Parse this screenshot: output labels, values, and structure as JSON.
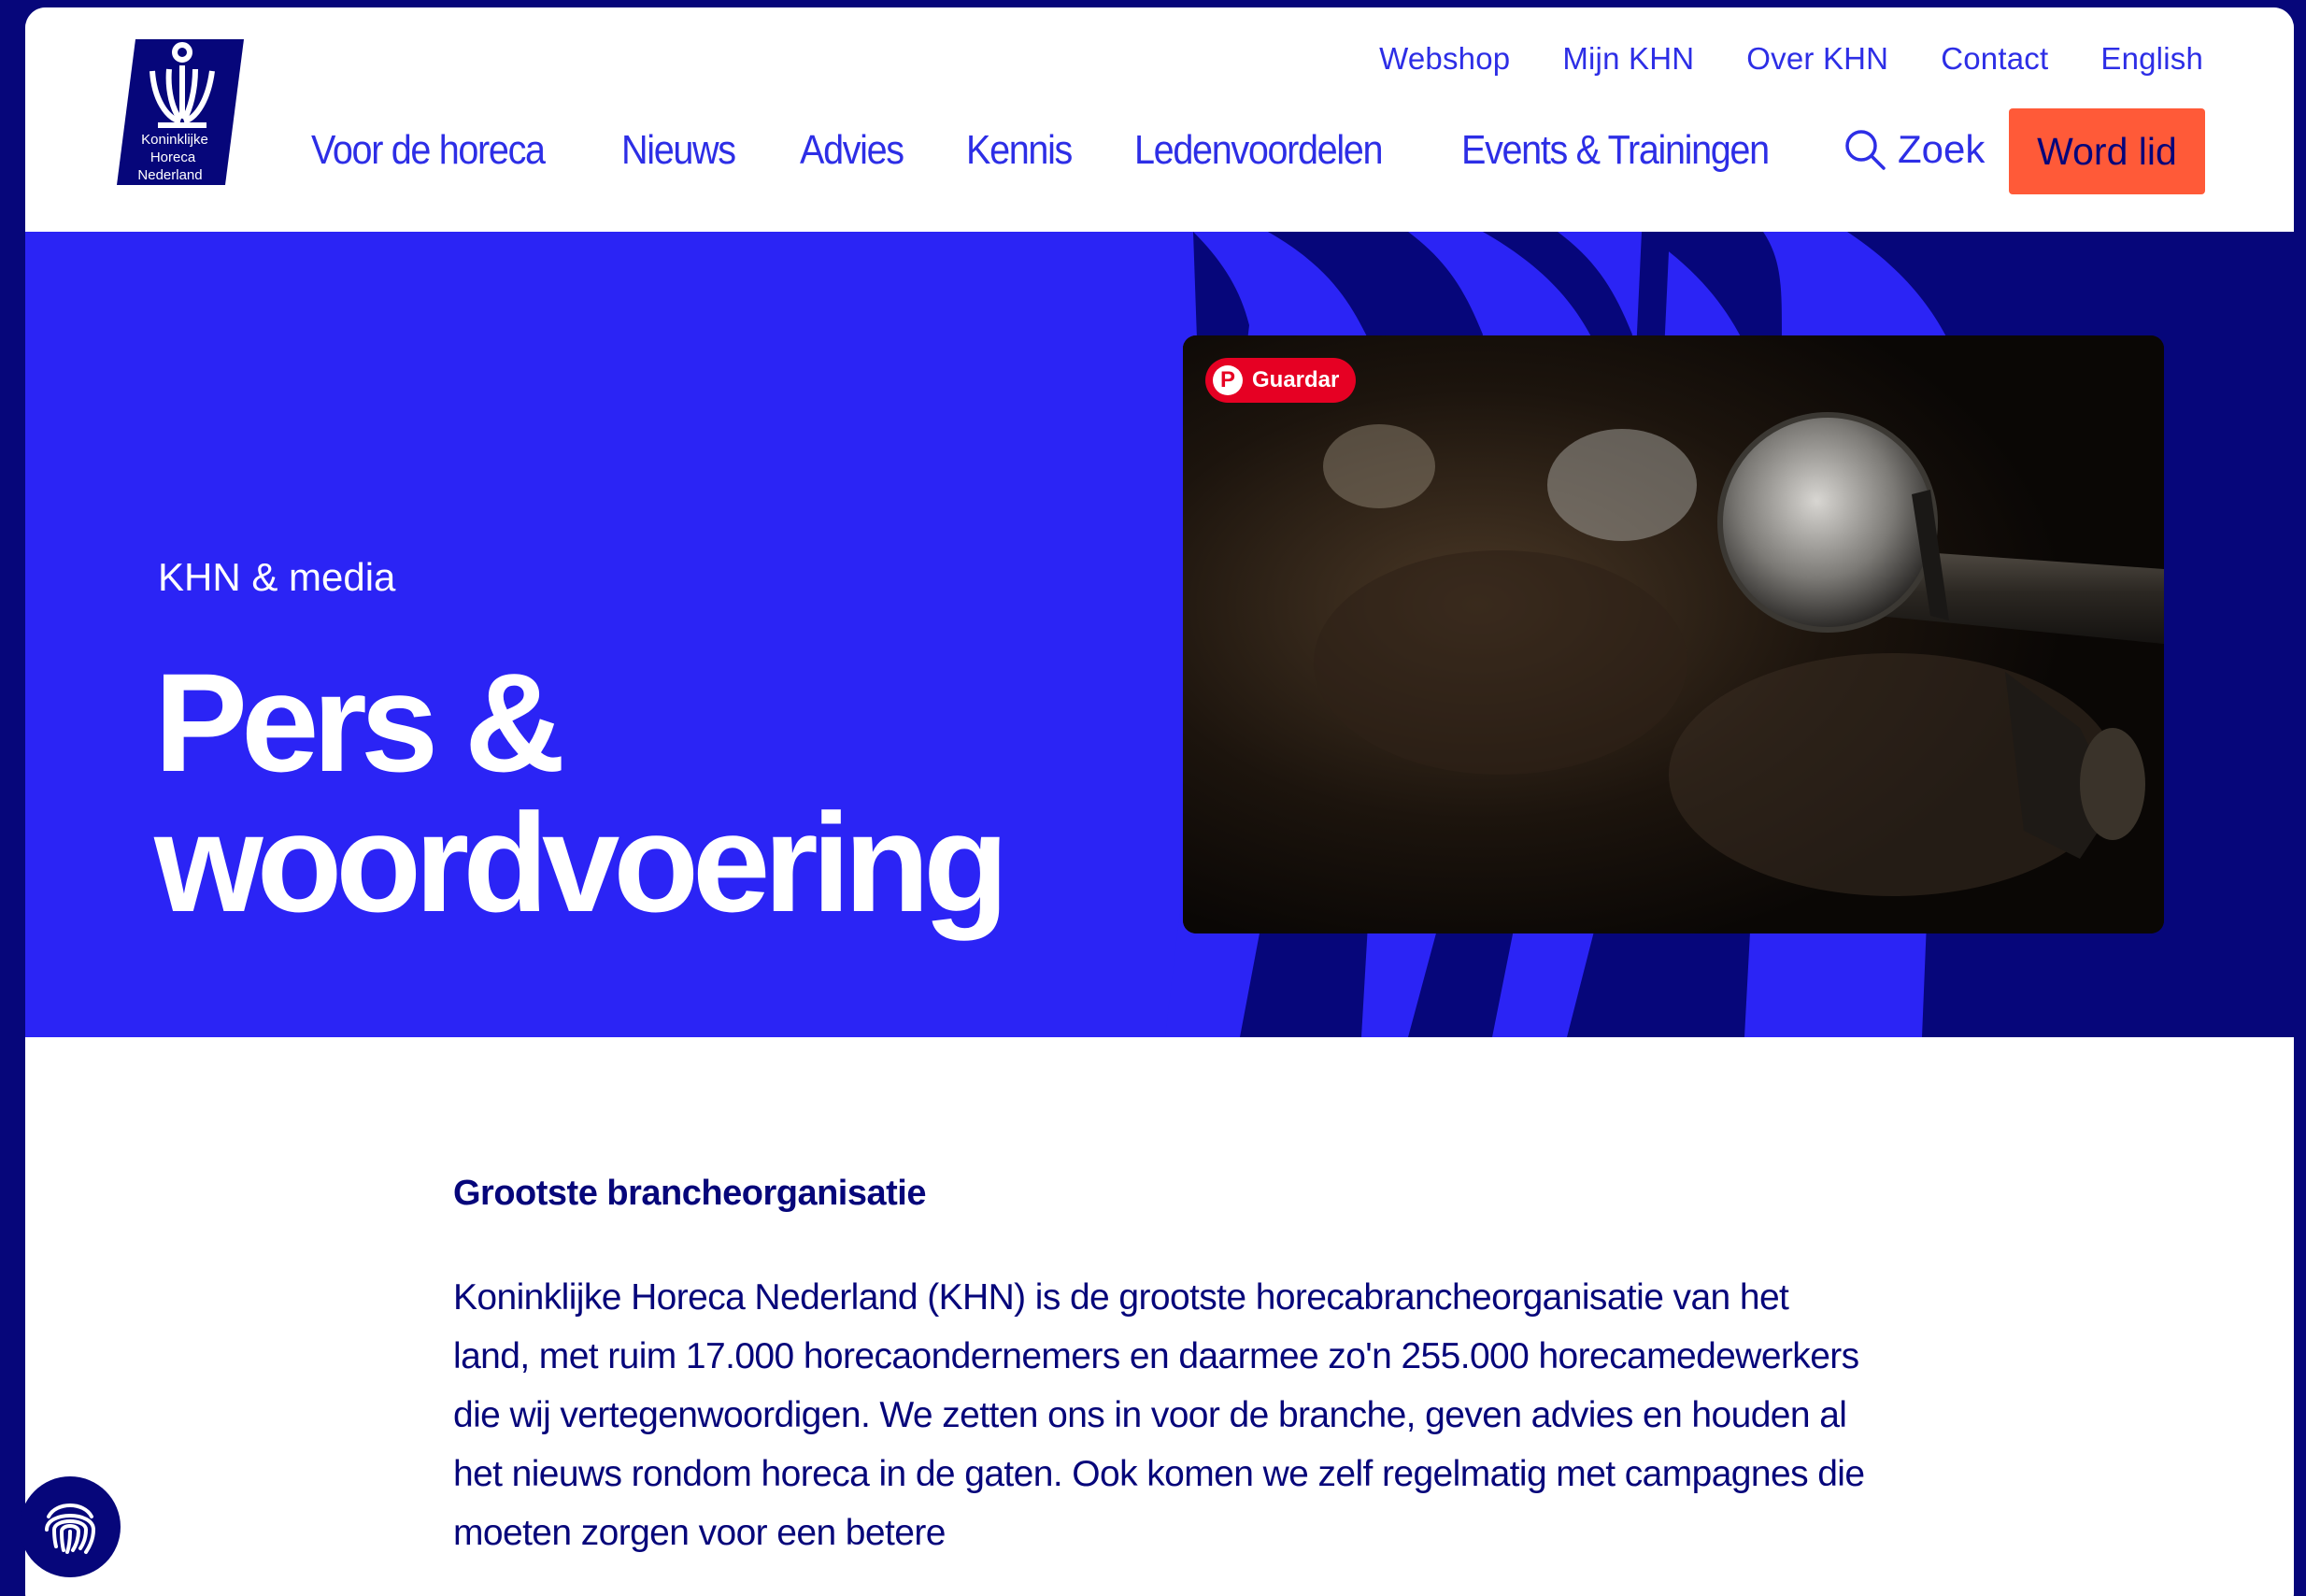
{
  "header": {
    "logo_text": "Koninklijke Horeca Nederland",
    "top_links": [
      "Webshop",
      "Mijn KHN",
      "Over KHN",
      "Contact",
      "English"
    ],
    "main_nav": [
      "Voor de horeca",
      "Nieuws",
      "Advies",
      "Kennis",
      "Ledenvoordelen",
      "Events & Trainingen"
    ],
    "search_label": "Zoek",
    "search_icon": "search-icon",
    "join_label": "Word lid"
  },
  "hero": {
    "eyebrow": "KHN & media",
    "title_line1": "Pers &",
    "title_line2": "woordvoering",
    "image_subject": "microphone-photo",
    "pin_label": "Guardar"
  },
  "content": {
    "heading": "Grootste brancheorganisatie",
    "paragraph": "Koninklijke Horeca Nederland (KHN) is de grootste horecabrancheorganisatie van het land, met ruim 17.000 horecaondernemers en daarmee zo'n 255.000 horecamedewerkers die wij vertegenwoordigen. We zetten ons in voor de branche, geven advies en houden al het nieuws rondom horeca in de gaten. Ook komen we zelf regelmatig met campagnes die moeten zorgen voor een betere"
  },
  "colors": {
    "navy": "#06067a",
    "blue": "#2b24f5",
    "link": "#2d2ee6",
    "accent": "#ff5a38",
    "pinterest": "#e60023"
  },
  "privacy_icon": "fingerprint-icon"
}
